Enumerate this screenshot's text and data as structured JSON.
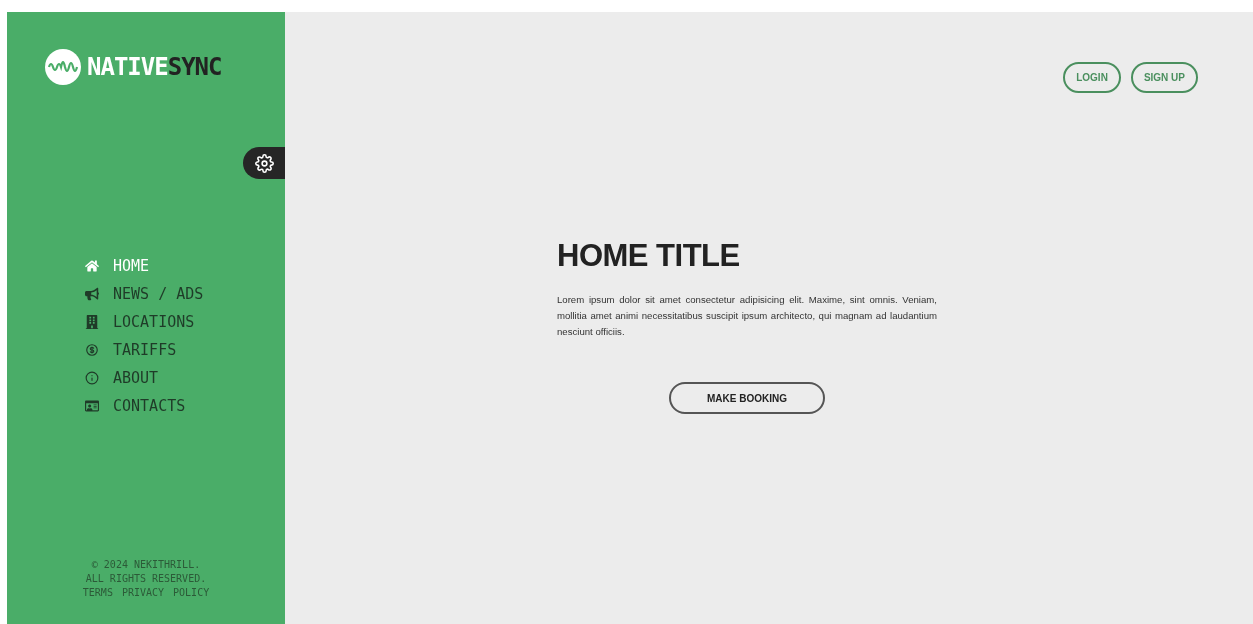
{
  "sidebar": {
    "logo": {
      "light": "NATIVE",
      "dark": "SYNC"
    },
    "nav": [
      {
        "kind": "home",
        "label": "HOME",
        "selected": true
      },
      {
        "kind": "megaphone",
        "label": "NEWS / ADS",
        "selected": false
      },
      {
        "kind": "building",
        "label": "LOCATIONS",
        "selected": false
      },
      {
        "kind": "dollar",
        "label": "TARIFFS",
        "selected": false
      },
      {
        "kind": "info",
        "label": "ABOUT",
        "selected": false
      },
      {
        "kind": "card",
        "label": "CONTACTS",
        "selected": false
      }
    ],
    "footer": {
      "copyright": "© 2024 NEKITHRILL.",
      "rights": "ALL RIGHTS RESERVED.",
      "links": [
        "TERMS",
        "PRIVACY",
        "POLICY"
      ]
    }
  },
  "header": {
    "buttons": [
      "LOGIN",
      "SIGN UP"
    ]
  },
  "hero": {
    "title": "HOME TITLE",
    "text": "Lorem ipsum dolor sit amet consectetur adipisicing elit. Maxime, sint omnis. Veniam, mollitia amet animi necessitatibus suscipit ipsum architecto, qui magnam ad laudantium nesciunt officiis.",
    "button": "MAKE BOOKING"
  }
}
